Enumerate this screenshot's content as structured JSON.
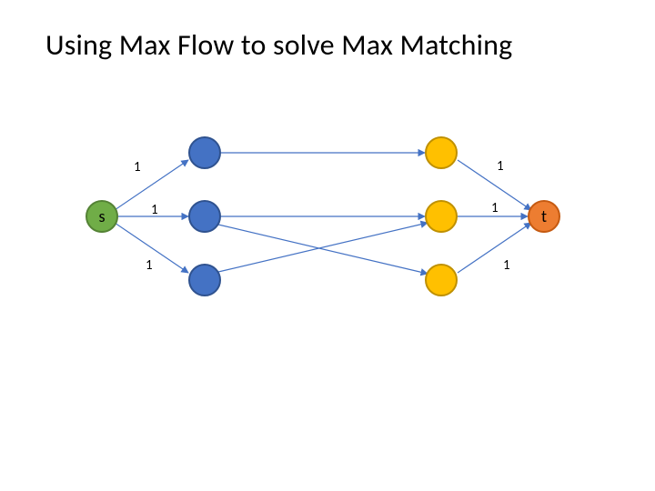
{
  "title": "Using Max Flow to solve Max Matching",
  "nodes": {
    "s": {
      "label": "s"
    },
    "t": {
      "label": "t"
    }
  },
  "edge_labels": {
    "s_l1": "1",
    "s_l2": "1",
    "s_l3": "1",
    "r1_t": "1",
    "r2_t": "1",
    "r3_t": "1"
  },
  "chart_data": {
    "type": "diagram",
    "title": "Using Max Flow to solve Max Matching",
    "nodes": [
      {
        "id": "s",
        "kind": "source",
        "label": "s"
      },
      {
        "id": "L1",
        "kind": "left",
        "label": ""
      },
      {
        "id": "L2",
        "kind": "left",
        "label": ""
      },
      {
        "id": "L3",
        "kind": "left",
        "label": ""
      },
      {
        "id": "R1",
        "kind": "right",
        "label": ""
      },
      {
        "id": "R2",
        "kind": "right",
        "label": ""
      },
      {
        "id": "R3",
        "kind": "right",
        "label": ""
      },
      {
        "id": "t",
        "kind": "sink",
        "label": "t"
      }
    ],
    "edges": [
      {
        "from": "s",
        "to": "L1",
        "capacity": 1
      },
      {
        "from": "s",
        "to": "L2",
        "capacity": 1
      },
      {
        "from": "s",
        "to": "L3",
        "capacity": 1
      },
      {
        "from": "L1",
        "to": "R1"
      },
      {
        "from": "L2",
        "to": "R2"
      },
      {
        "from": "L2",
        "to": "R3"
      },
      {
        "from": "L3",
        "to": "R2"
      },
      {
        "from": "R1",
        "to": "t",
        "capacity": 1
      },
      {
        "from": "R2",
        "to": "t",
        "capacity": 1
      },
      {
        "from": "R3",
        "to": "t",
        "capacity": 1
      }
    ]
  }
}
